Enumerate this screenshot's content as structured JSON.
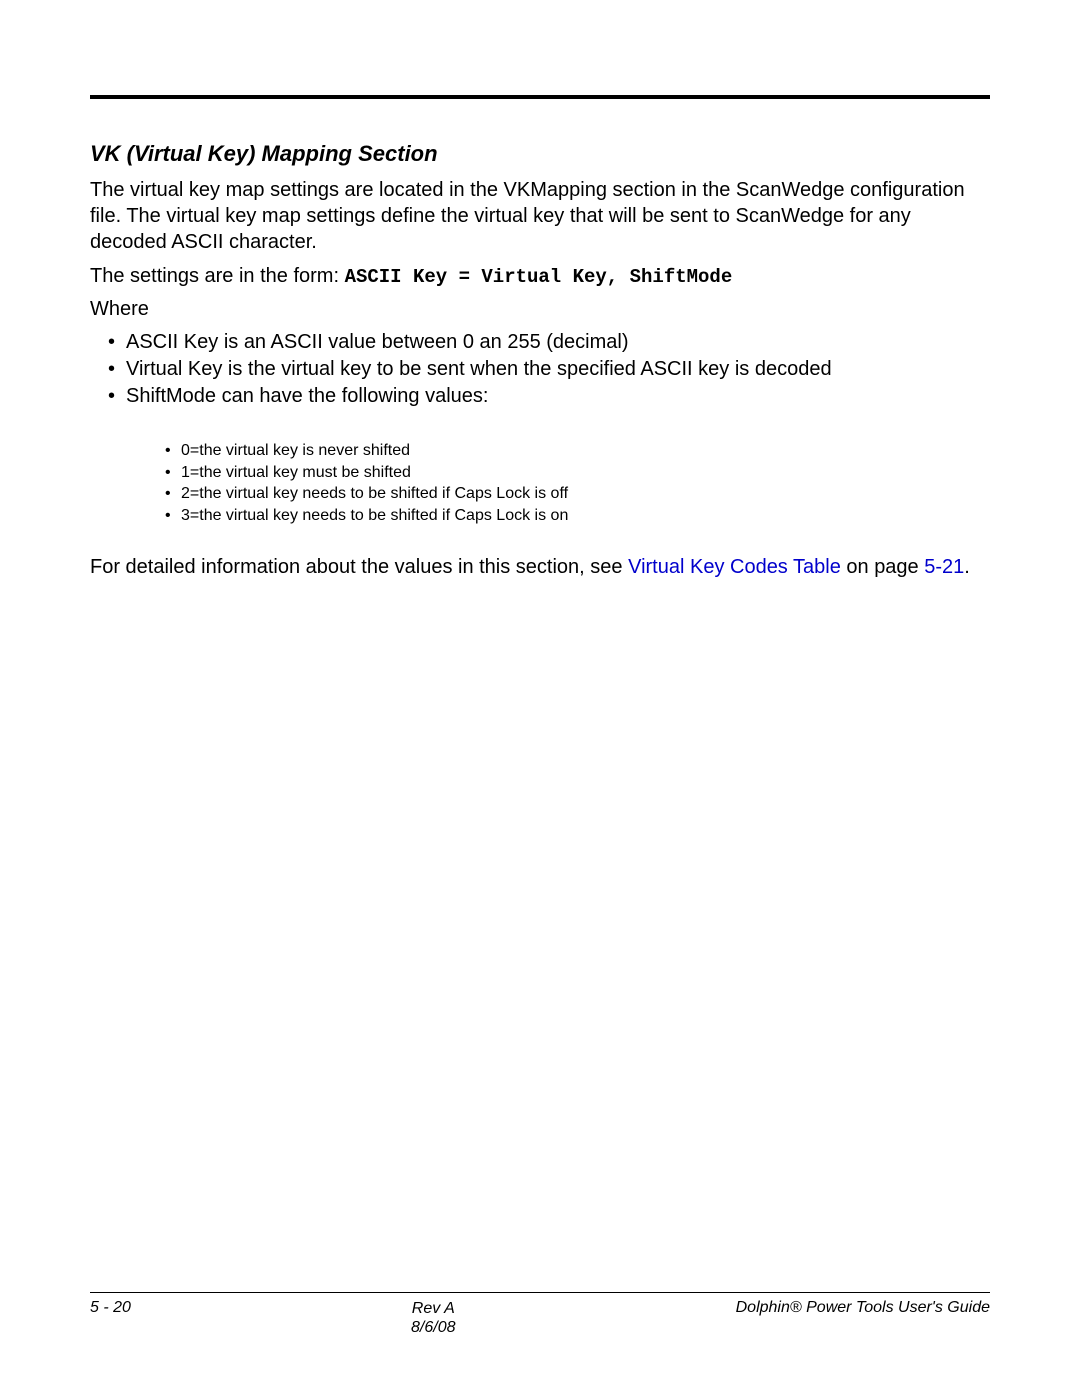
{
  "heading": "VK (Virtual Key) Mapping Section",
  "intro": "The virtual key map settings are located in the VKMapping section in the ScanWedge configuration file. The virtual key map settings define the virtual key that will be sent to ScanWedge for any decoded ASCII character.",
  "form_prefix": "The settings are in the form: ",
  "form_code": "ASCII Key = Virtual Key, ShiftMode",
  "where": "Where",
  "bullets": [
    "ASCII Key is an ASCII value between 0 an 255 (decimal)",
    "Virtual Key is the virtual key to be sent when the specified ASCII key is decoded",
    "ShiftMode can have the following values:"
  ],
  "sub_bullets": [
    "0=the virtual key is never shifted",
    "1=the virtual key must be shifted",
    "2=the virtual key needs to be shifted if Caps Lock is off",
    "3=the virtual key needs to be shifted if Caps Lock is on"
  ],
  "detail_prefix": "For detailed information about the values in this section, see ",
  "detail_link": "Virtual Key Codes Table",
  "detail_mid": " on page ",
  "detail_page": "5-21",
  "detail_suffix": ".",
  "footer": {
    "left": "5 - 20",
    "center_top": "Rev A",
    "center_bottom": "8/6/08",
    "right": "Dolphin® Power Tools User's Guide"
  }
}
